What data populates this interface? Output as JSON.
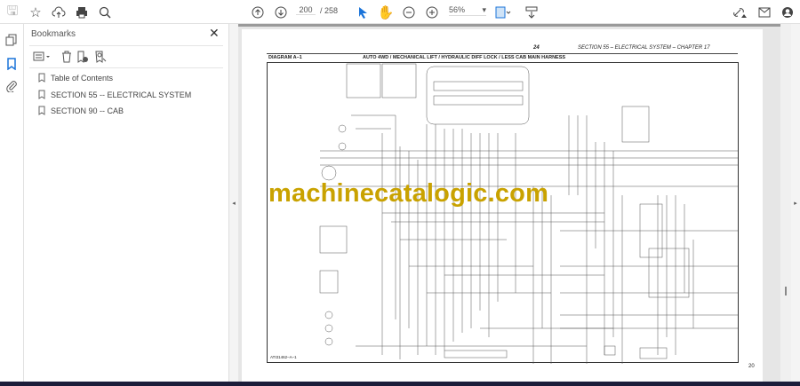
{
  "toolbar": {
    "page_current": "200",
    "page_total": "/ 258",
    "zoom": "56%",
    "zoom_caret": "▾"
  },
  "bookmarks": {
    "title": "Bookmarks",
    "close": "✕",
    "items": [
      {
        "label": "Table of Contents"
      },
      {
        "label": "SECTION 55 -- ELECTRICAL SYSTEM"
      },
      {
        "label": "SECTION 90 -- CAB"
      }
    ]
  },
  "document": {
    "page_number": "24",
    "header_right": "SECTION 55 – ELECTRICAL SYSTEM – CHAPTER 17",
    "diagram_label": "DIAGRAM A–1",
    "diagram_title": "AUTO 4WD / MECHANICAL LIFT / HYDRAULIC DIFF LOCK / LESS CAB MAIN HARNESS",
    "figure_id": "ATI31462–A–1",
    "footer_number": "20",
    "watermark": "machinecatalogic.com"
  },
  "handles": {
    "left": "◂",
    "right": "▸"
  },
  "colors": {
    "accent": "#1a73d9",
    "watermark": "#c9a200"
  }
}
